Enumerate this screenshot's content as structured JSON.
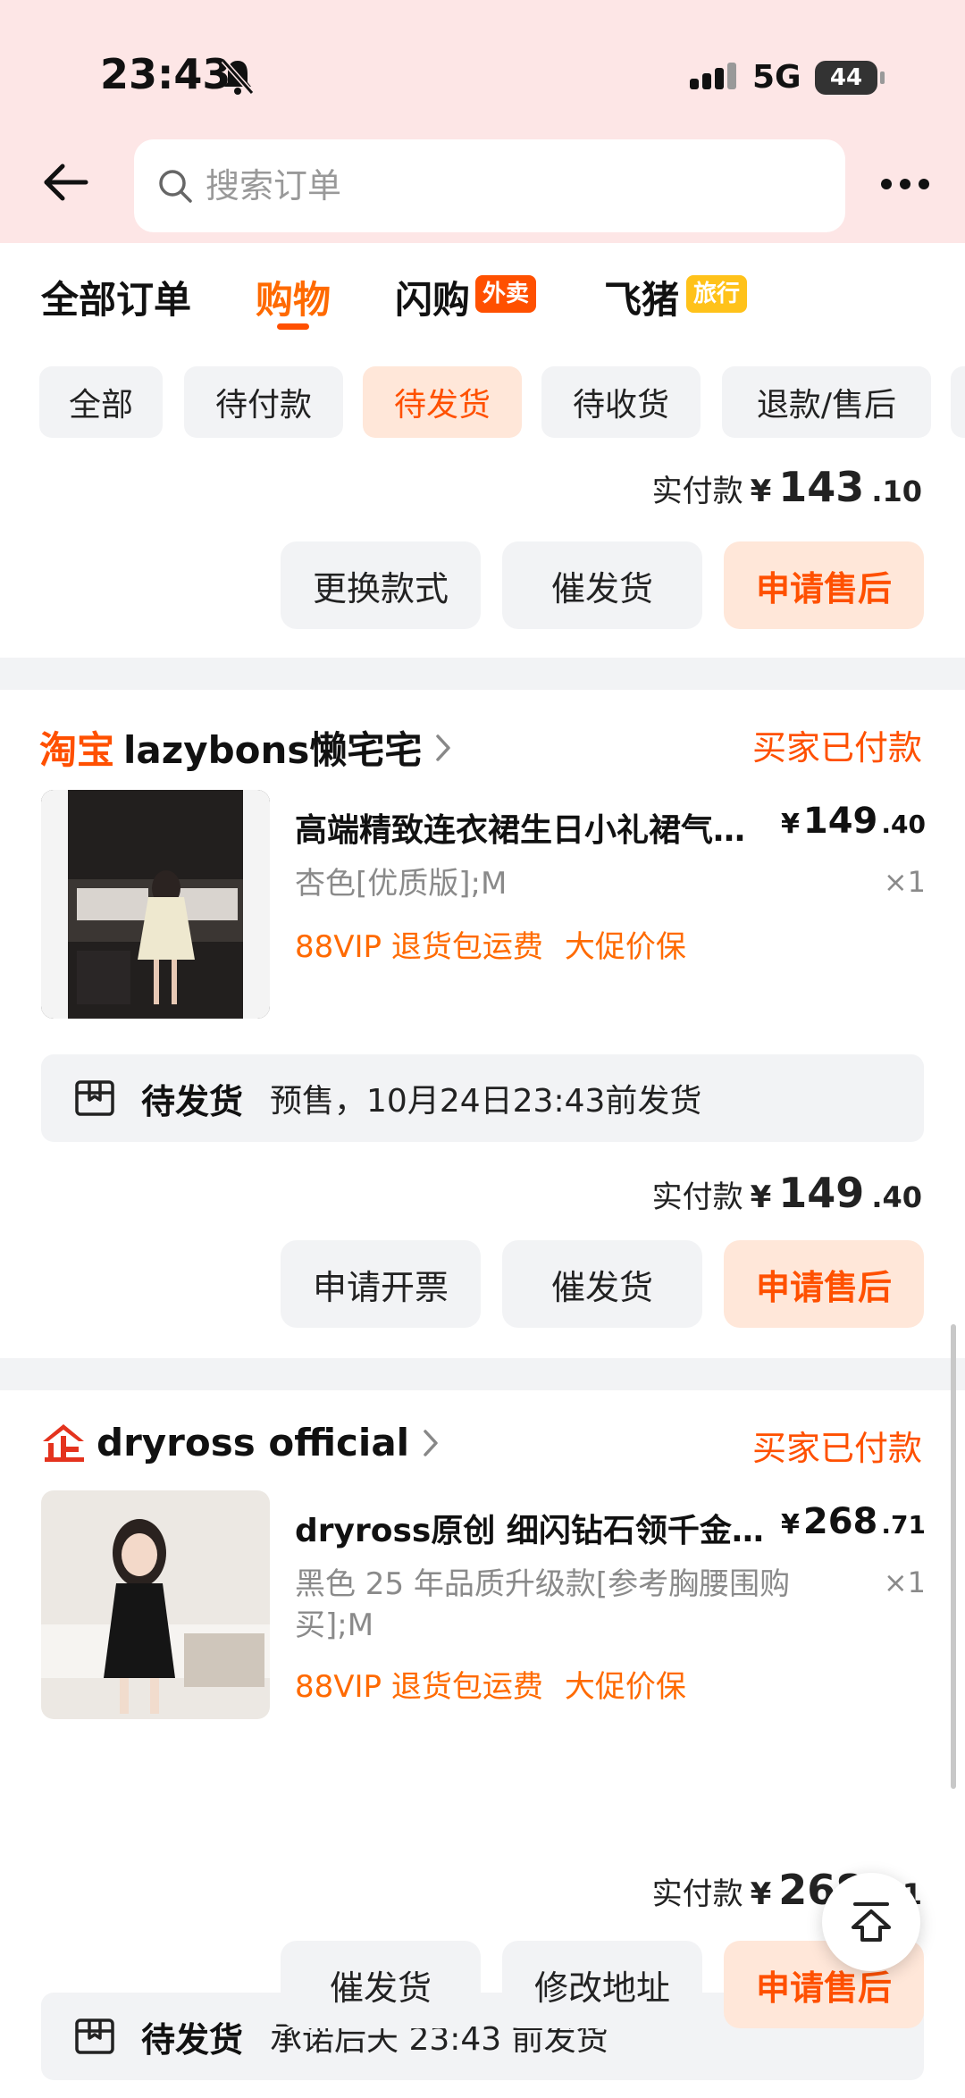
{
  "status_bar": {
    "time": "23:43",
    "network": "5G",
    "battery": "44"
  },
  "search": {
    "placeholder": "搜索订单"
  },
  "tabs": [
    {
      "label": "全部订单"
    },
    {
      "label": "购物",
      "active": true
    },
    {
      "label": "闪购",
      "badge": "外卖"
    },
    {
      "label": "飞猪",
      "badge": "旅行"
    }
  ],
  "filters": [
    {
      "label": "全部"
    },
    {
      "label": "待付款"
    },
    {
      "label": "待发货",
      "active": true
    },
    {
      "label": "待收货"
    },
    {
      "label": "退款/售后"
    }
  ],
  "order0": {
    "pay_label": "实付款",
    "pay_yen": "¥",
    "pay_int": "143",
    "pay_dec": ".10",
    "buttons": [
      "更换款式",
      "催发货",
      "申请售后"
    ]
  },
  "order1": {
    "platform": "淘宝",
    "shop": "lazybons懒宅宅",
    "status": "买家已付款",
    "product": {
      "title": "高端精致连衣裙生日小礼裙气质高级感",
      "price_yen": "¥",
      "price_int": "149",
      "price_dec": ".40",
      "spec": "杏色[优质版];M",
      "qty": "×1",
      "tags": [
        "88VIP 退货包运费",
        "大促价保"
      ]
    },
    "ship_status": "待发货",
    "ship_note": "预售，10月24日23:43前发货",
    "pay_label": "实付款",
    "pay_yen": "¥",
    "pay_int": "149",
    "pay_dec": ".40",
    "buttons": [
      "申请开票",
      "催发货",
      "申请售后"
    ]
  },
  "order2": {
    "shop": "dryross official",
    "status": "买家已付款",
    "product": {
      "title": "dryross原创 细闪钻石领千金风连衣裙",
      "price_yen": "¥",
      "price_int": "268",
      "price_dec": ".71",
      "spec": "黑色 25 年品质升级款[参考胸腰围购买];M",
      "qty": "×1",
      "tags": [
        "88VIP 退货包运费",
        "大促价保"
      ]
    },
    "ship_status": "待发货",
    "ship_note": "承诺后天 23:43 前发货",
    "pay_label": "实付款",
    "pay_yen": "¥",
    "pay_int": "268",
    "pay_dec": ".71",
    "buttons": [
      "催发货",
      "修改地址",
      "申请售后"
    ]
  },
  "colors": {
    "accent": "#ff5000",
    "header_bg": "#fde6e6",
    "page_bg": "#f2f3f5"
  }
}
